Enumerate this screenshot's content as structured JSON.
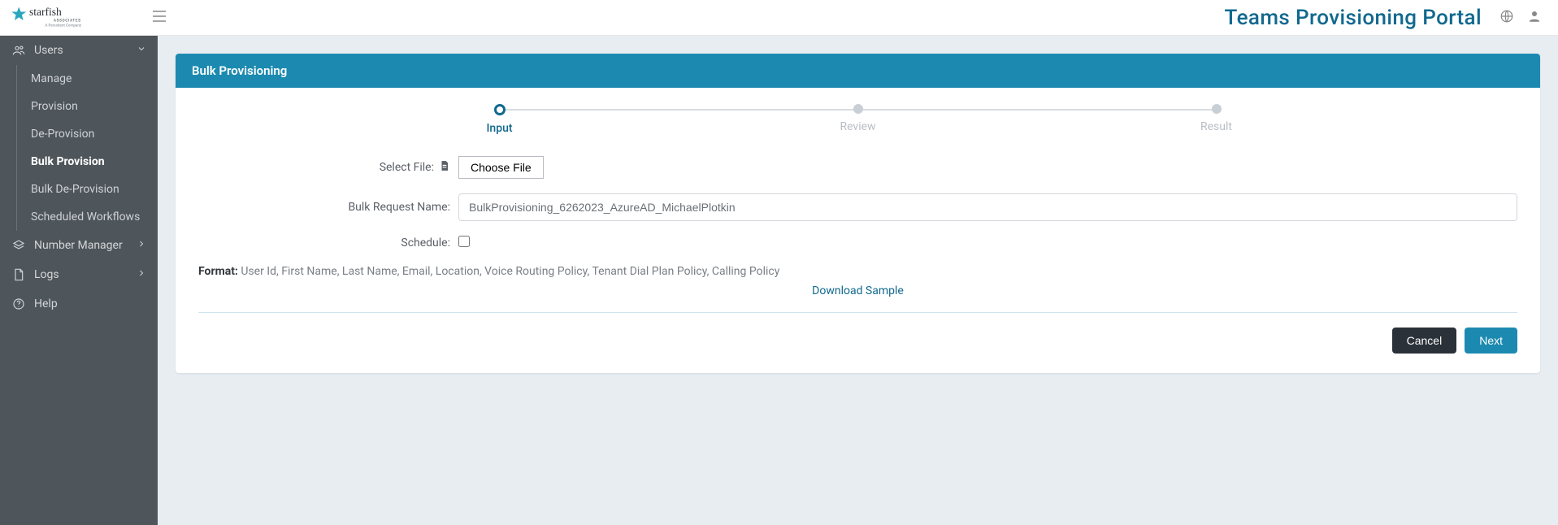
{
  "header": {
    "portal_title": "Teams Provisioning Portal"
  },
  "logo": {
    "brand": "starfish",
    "sub1": "ASSOCIATES",
    "sub2": "A Persistent Company"
  },
  "sidebar": {
    "users": {
      "label": "Users",
      "expanded": true
    },
    "users_items": [
      {
        "label": "Manage"
      },
      {
        "label": "Provision"
      },
      {
        "label": "De-Provision"
      },
      {
        "label": "Bulk Provision",
        "active": true
      },
      {
        "label": "Bulk De-Provision"
      },
      {
        "label": "Scheduled Workflows"
      }
    ],
    "number_manager": {
      "label": "Number Manager"
    },
    "logs": {
      "label": "Logs"
    },
    "help": {
      "label": "Help"
    }
  },
  "card": {
    "title": "Bulk Provisioning"
  },
  "stepper": {
    "steps": [
      "Input",
      "Review",
      "Result"
    ],
    "active_index": 0
  },
  "form": {
    "select_file_label": "Select File:",
    "choose_file_button": "Choose File",
    "bulk_request_label": "Bulk Request Name:",
    "bulk_request_value": "BulkProvisioning_6262023_AzureAD_MichaelPlotkin",
    "schedule_label": "Schedule:",
    "schedule_checked": false,
    "format_prefix": "Format:",
    "format_text": "User Id, First Name, Last Name, Email, Location, Voice Routing Policy, Tenant Dial Plan Policy, Calling Policy",
    "download_sample": "Download Sample",
    "cancel": "Cancel",
    "next": "Next"
  },
  "colors": {
    "accent": "#11698e",
    "header_bg": "#1c8ab0",
    "sidebar_bg": "#4e555b"
  }
}
